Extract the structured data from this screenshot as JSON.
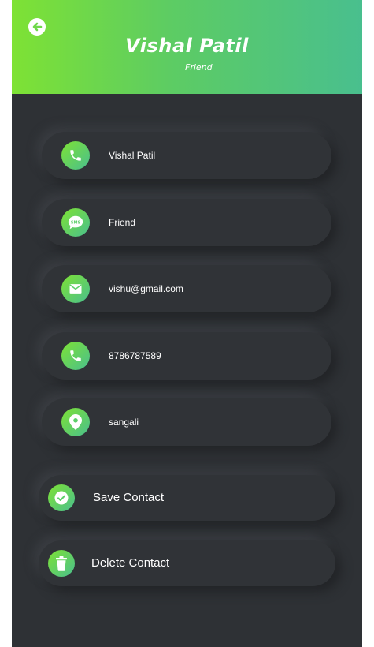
{
  "header": {
    "title": "Vishal Patil",
    "subtitle": "Friend",
    "back_icon": "arrow-left-circle-icon"
  },
  "fields": [
    {
      "icon": "phone-icon",
      "value": "Vishal Patil"
    },
    {
      "icon": "sms-chat-icon",
      "value": "Friend"
    },
    {
      "icon": "email-icon",
      "value": "vishu@gmail.com"
    },
    {
      "icon": "phone-icon",
      "value": "8786787589"
    },
    {
      "icon": "location-pin-icon",
      "value": "sangali"
    }
  ],
  "actions": {
    "save_label": "Save Contact",
    "delete_label": "Delete Contact"
  },
  "colors": {
    "background": "#2e3135",
    "accent_start": "#7ee234",
    "accent_end": "#49bf8e",
    "text": "#ffffff"
  }
}
